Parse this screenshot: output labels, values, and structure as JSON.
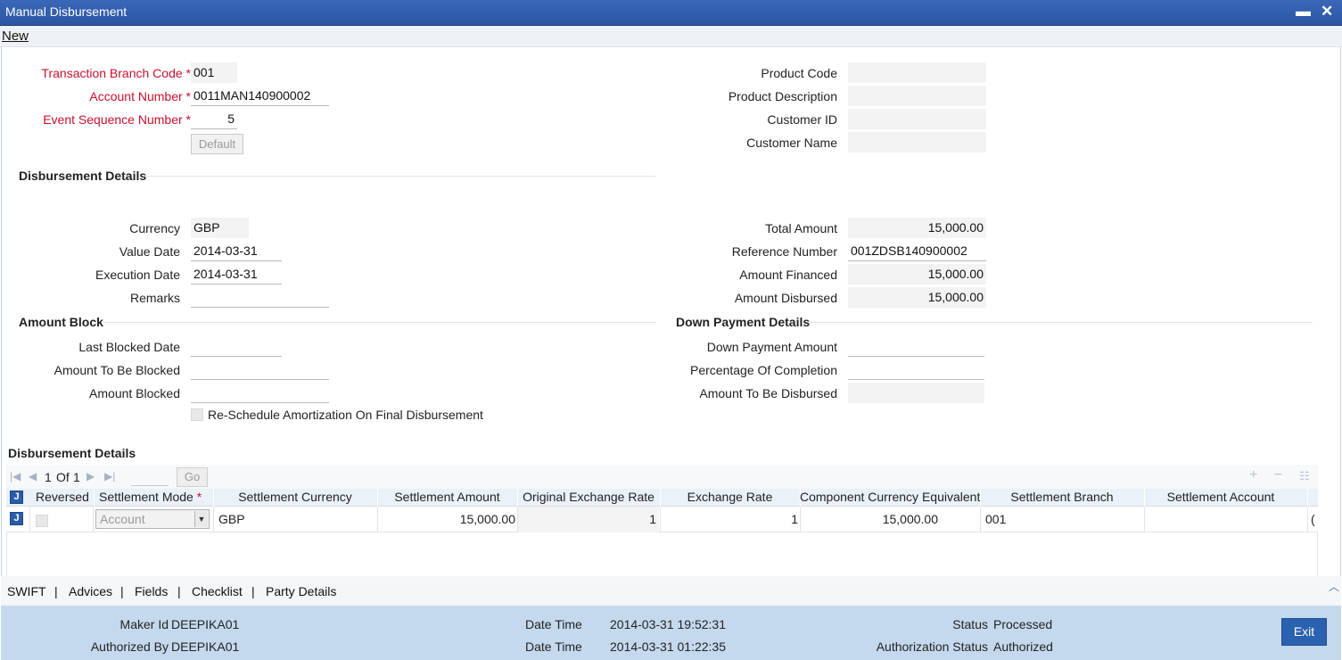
{
  "window": {
    "title": "Manual Disbursement",
    "minimize_glyph": "▬",
    "close_glyph": "✕"
  },
  "toolbar": {
    "new_label": "New"
  },
  "header": {
    "branch_code_label": "Transaction Branch Code",
    "branch_code_value": "001",
    "account_number_label": "Account Number",
    "account_number_value": "0011MAN140900002",
    "event_seq_label": "Event Sequence Number",
    "event_seq_value": "5",
    "default_button": "Default",
    "product_code_label": "Product Code",
    "product_code_value": "",
    "product_desc_label": "Product Description",
    "product_desc_value": "",
    "customer_id_label": "Customer ID",
    "customer_id_value": "",
    "customer_name_label": "Customer Name",
    "customer_name_value": ""
  },
  "disbursement": {
    "section_title": "Disbursement Details",
    "currency_label": "Currency",
    "currency_value": "GBP",
    "value_date_label": "Value Date",
    "value_date_value": "2014-03-31",
    "execution_date_label": "Execution Date",
    "execution_date_value": "2014-03-31",
    "remarks_label": "Remarks",
    "remarks_value": "",
    "total_amount_label": "Total Amount",
    "total_amount_value": "15,000.00",
    "reference_number_label": "Reference Number",
    "reference_number_value": "001ZDSB140900002",
    "amount_financed_label": "Amount Financed",
    "amount_financed_value": "15,000.00",
    "amount_disbursed_label": "Amount Disbursed",
    "amount_disbursed_value": "15,000.00"
  },
  "amount_block": {
    "section_title": "Amount Block",
    "last_blocked_date_label": "Last Blocked Date",
    "amount_to_be_blocked_label": "Amount To Be Blocked",
    "amount_blocked_label": "Amount Blocked",
    "reschedule_label": "Re-Schedule Amortization On Final Disbursement"
  },
  "down_payment": {
    "section_title": "Down Payment Details",
    "down_payment_amount_label": "Down Payment Amount",
    "percentage_completion_label": "Percentage Of Completion",
    "amount_to_be_disbursed_label": "Amount To Be Disbursed"
  },
  "grid": {
    "section_title": "Disbursement Details",
    "pager_current": "1",
    "pager_of": "Of",
    "pager_total": "1",
    "go_label": "Go",
    "columns": [
      "Reversed",
      "Settlement Mode",
      "Settlement Currency",
      "Settlement Amount",
      "Original Exchange Rate",
      "Exchange Rate",
      "Component Currency Equivalent",
      "Settlement Branch",
      "Settlement Account"
    ],
    "row": {
      "settlement_mode": "Account",
      "settlement_currency": "GBP",
      "settlement_amount": "15,000.00",
      "original_exchange_rate": "1",
      "exchange_rate": "1",
      "component_currency_equivalent": "15,000.00",
      "settlement_branch": "001",
      "settlement_account": "",
      "overflow": "("
    }
  },
  "tabs": [
    "SWIFT",
    "Advices",
    "Fields",
    "Checklist",
    "Party Details"
  ],
  "tab_separator": "|",
  "footer": {
    "maker_id_label": "Maker Id",
    "maker_id_value": "DEEPIKA01",
    "authorized_by_label": "Authorized By",
    "authorized_by_value": "DEEPIKA01",
    "date_time_label": "Date Time",
    "maker_date_time": "2014-03-31 19:52:31",
    "auth_date_time": "2014-03-31 01:22:35",
    "status_label": "Status",
    "status_value": "Processed",
    "auth_status_label": "Authorization Status",
    "auth_status_value": "Authorized",
    "exit_label": "Exit"
  },
  "colors": {
    "titlebar": "#2b56a4",
    "required": "#c8102e",
    "footer": "#c5d9ee",
    "exit_button": "#2a62b0"
  }
}
